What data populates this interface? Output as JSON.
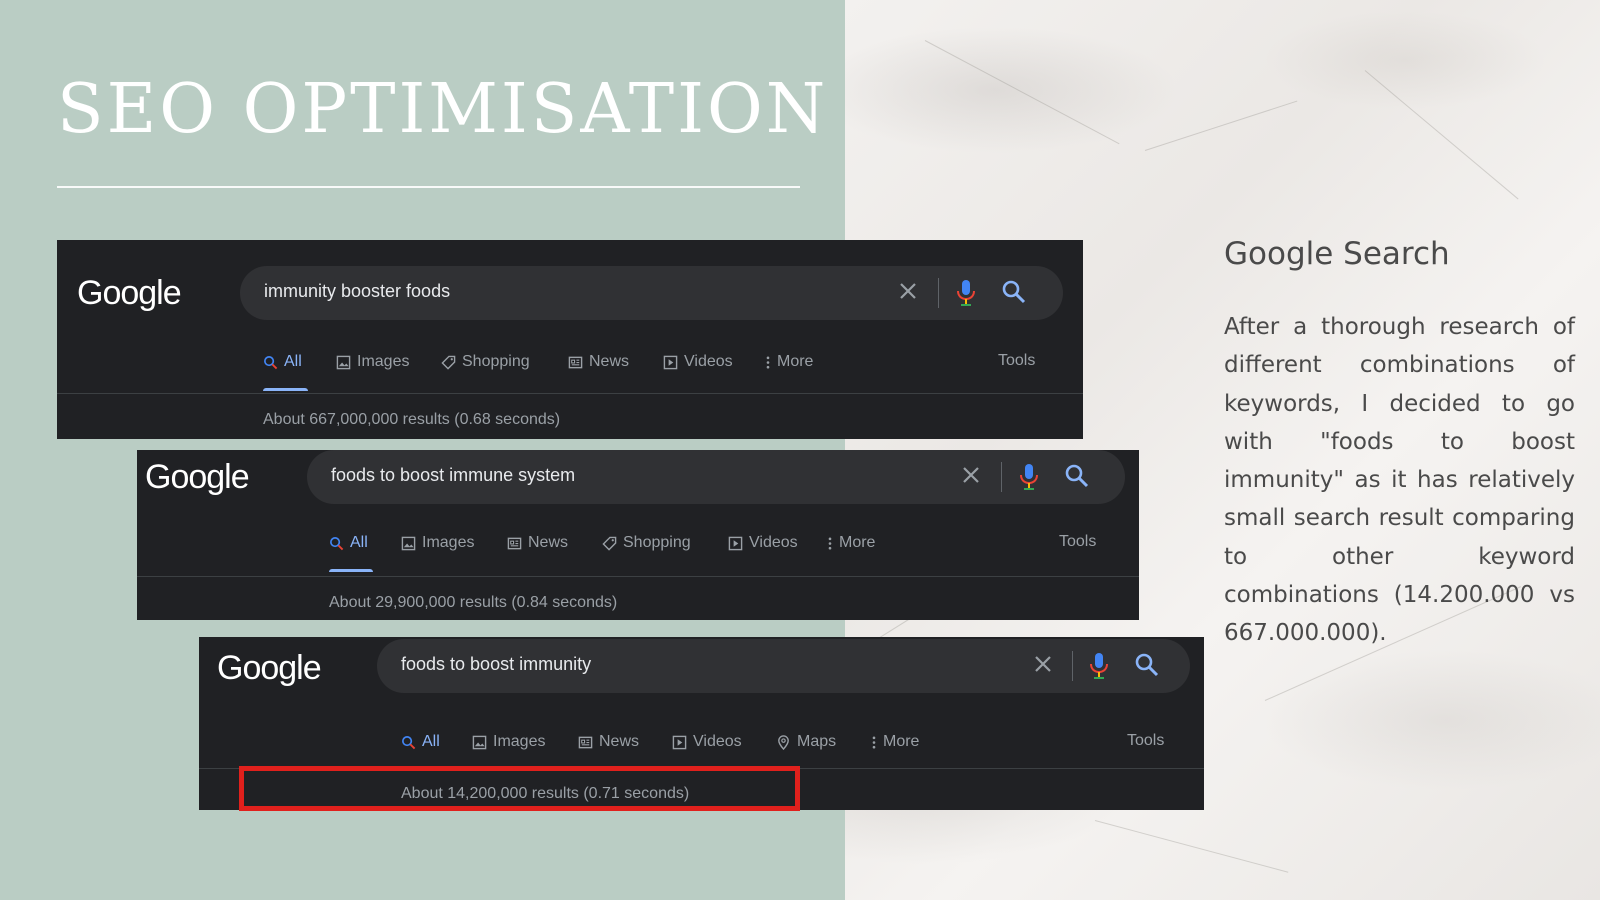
{
  "slide": {
    "title": "SEO OPTIMISATION",
    "side_heading": "Google Search",
    "side_body": "After a thorough research of different combinations of keywords, I decided to go with \"foods to boost immunity\" as it has relatively small search result comparing to other keyword combinations (14.200.000 vs 667.000.000)."
  },
  "colors": {
    "left_panel": "#bacdc4",
    "google_dark": "#202124",
    "search_bar": "#303134",
    "active_tab": "#8ab4f8",
    "highlight": "#e0201c"
  },
  "screenshots": [
    {
      "logo": "Google",
      "query": "immunity booster foods",
      "tabs": [
        {
          "label": "All",
          "icon": "search-icon",
          "active": true
        },
        {
          "label": "Images",
          "icon": "image-icon"
        },
        {
          "label": "Shopping",
          "icon": "tag-icon"
        },
        {
          "label": "News",
          "icon": "newspaper-icon"
        },
        {
          "label": "Videos",
          "icon": "play-icon"
        },
        {
          "label": "More",
          "icon": "more-vert-icon"
        }
      ],
      "tools": "Tools",
      "stats": "About 667,000,000 results (0.68 seconds)"
    },
    {
      "logo": "Google",
      "query": "foods to boost immune system",
      "tabs": [
        {
          "label": "All",
          "icon": "search-icon",
          "active": true
        },
        {
          "label": "Images",
          "icon": "image-icon"
        },
        {
          "label": "News",
          "icon": "newspaper-icon"
        },
        {
          "label": "Shopping",
          "icon": "tag-icon"
        },
        {
          "label": "Videos",
          "icon": "play-icon"
        },
        {
          "label": "More",
          "icon": "more-vert-icon"
        }
      ],
      "tools": "Tools",
      "stats": "About 29,900,000 results (0.84 seconds)"
    },
    {
      "logo": "Google",
      "query": "foods to boost immunity",
      "tabs": [
        {
          "label": "All",
          "icon": "search-icon",
          "active": true
        },
        {
          "label": "Images",
          "icon": "image-icon"
        },
        {
          "label": "News",
          "icon": "newspaper-icon"
        },
        {
          "label": "Videos",
          "icon": "play-icon"
        },
        {
          "label": "Maps",
          "icon": "map-pin-icon"
        },
        {
          "label": "More",
          "icon": "more-vert-icon"
        }
      ],
      "tools": "Tools",
      "stats": "About 14,200,000 results (0.71 seconds)"
    }
  ]
}
